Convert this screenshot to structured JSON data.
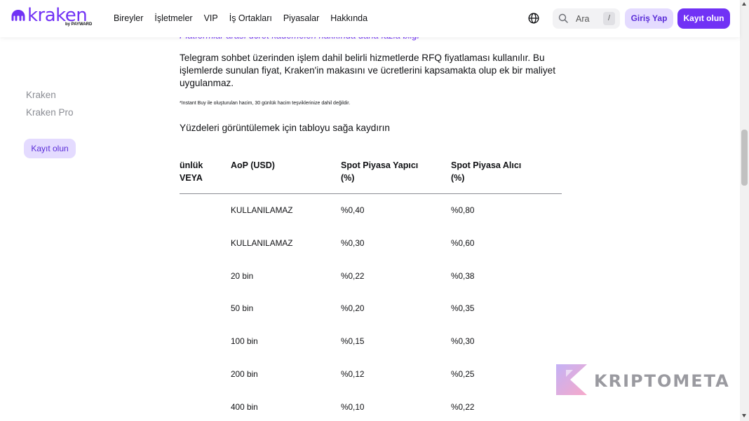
{
  "header": {
    "logo_text": "kraken",
    "logo_sub": "by PAYWARD",
    "nav": [
      "Bireyler",
      "İşletmeler",
      "VIP",
      "İş Ortakları",
      "Piyasalar",
      "Hakkında"
    ],
    "search_placeholder": "Ara",
    "search_shortcut": "/",
    "login_label": "Giriş Yap",
    "signup_label": "Kayıt olun"
  },
  "sidebar": {
    "links": [
      "Kraken",
      "Kraken Pro"
    ],
    "signup_label": "Kayıt olun"
  },
  "content": {
    "cut_link": "Platformlar arası ücret kademeleri hakkında daha fazla bilgi",
    "paragraph": "Telegram sohbet üzerinden işlem dahil belirli hizmetlerde RFQ fiyatlaması kullanılır. Bu işlemlerde sunulan fiyat, Kraken'in makasını ve ücretlerini kapsamakta olup ek bir maliyet uygulanmaz.",
    "footnote": "*Instant Buy ile oluşturulan hacim, 30 günlük hacim teşviklerinize dahil değildir.",
    "scroll_hint": "Yüzdeleri görüntülemek için tabloyu sağa kaydırın"
  },
  "table": {
    "headers": {
      "col0_line1": "ünlük",
      "col0_line2": "VEYA",
      "col1": "AoP (USD)",
      "col2_line1": "Spot Piyasa Yapıcı",
      "col2_line2": "(%)",
      "col3_line1": "Spot Piyasa Alıcı",
      "col3_line2": "(%)"
    },
    "rows": [
      {
        "aop": "KULLANILAMAZ",
        "maker": "%0,40",
        "taker": "%0,80"
      },
      {
        "aop": "KULLANILAMAZ",
        "maker": "%0,30",
        "taker": "%0,60"
      },
      {
        "aop": "20 bin",
        "maker": "%0,22",
        "taker": "%0,38"
      },
      {
        "aop": "50 bin",
        "maker": "%0,20",
        "taker": "%0,35"
      },
      {
        "aop": "100 bin",
        "maker": "%0,15",
        "taker": "%0,30"
      },
      {
        "aop": "200 bin",
        "maker": "%0,12",
        "taker": "%0,25"
      },
      {
        "aop": "400 bin",
        "maker": "%0,10",
        "taker": "%0,22"
      }
    ]
  },
  "watermark": {
    "text": "KRIPTOMETA"
  },
  "colors": {
    "brand": "#7132f5",
    "brand_light": "#e4dbff",
    "muted": "#8a8c93"
  }
}
